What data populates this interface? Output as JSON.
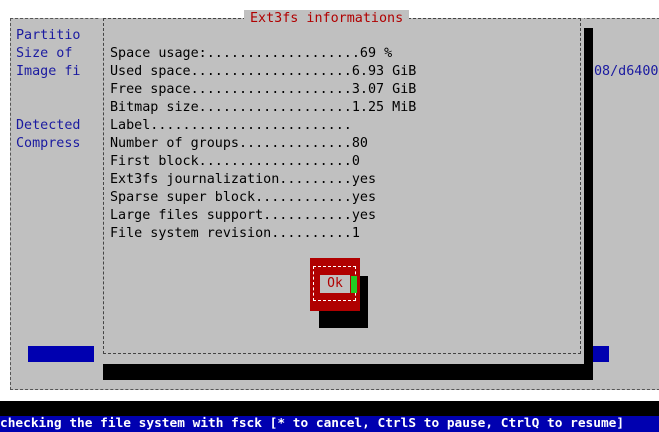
{
  "background": {
    "labels": [
      "Partitio",
      "Size of",
      "Image fi",
      "Detected",
      "Compress"
    ],
    "image_path_fragment": "08/d6400",
    "progress_color": "#0000b0"
  },
  "dialog": {
    "title": "Ext3fs informations",
    "rows": [
      "Space usage:...................69 %",
      "Used space....................6.93 GiB",
      "Free space....................3.07 GiB",
      "Bitmap size...................1.25 MiB",
      "Label.........................",
      "Number of groups..............80",
      "First block...................0",
      "Ext3fs journalization.........yes",
      "Sparse super block............yes",
      "Large files support...........yes",
      "File system revision..........1"
    ],
    "ok_label": "Ok"
  },
  "status": {
    "text": "checking the file system with fsck [* to cancel, CtrlS to pause, CtrlQ to resume]"
  },
  "colors": {
    "title": "#b00000",
    "button_bg": "#b00000",
    "status_bg": "#0000b0",
    "cursor": "#22cc22"
  }
}
